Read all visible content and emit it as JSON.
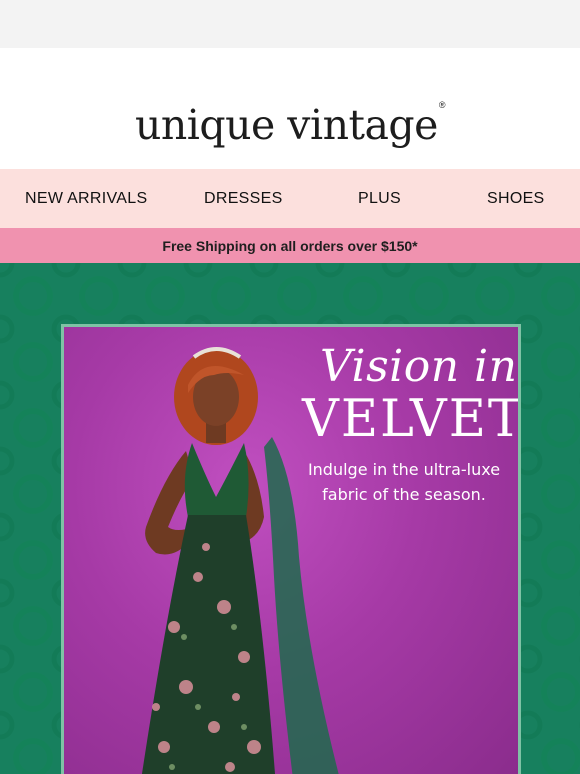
{
  "brand": {
    "logo_text": "unique vintage",
    "trademark": "®"
  },
  "nav": {
    "items": [
      {
        "label": "NEW ARRIVALS"
      },
      {
        "label": "DRESSES"
      },
      {
        "label": "PLUS"
      },
      {
        "label": "SHOES"
      }
    ]
  },
  "promo": {
    "text": "Free Shipping on all orders over $150*"
  },
  "hero": {
    "headline_script": "Vision in",
    "headline_caps": "VELVET",
    "subtext": "Indulge in the ultra-luxe fabric of the season."
  },
  "colors": {
    "nav_bg": "#fce0dd",
    "promo_bg": "#f092af",
    "hero_green": "#17805e",
    "panel_magenta": "#a63aa6",
    "dress_green": "#1f4a2e"
  }
}
